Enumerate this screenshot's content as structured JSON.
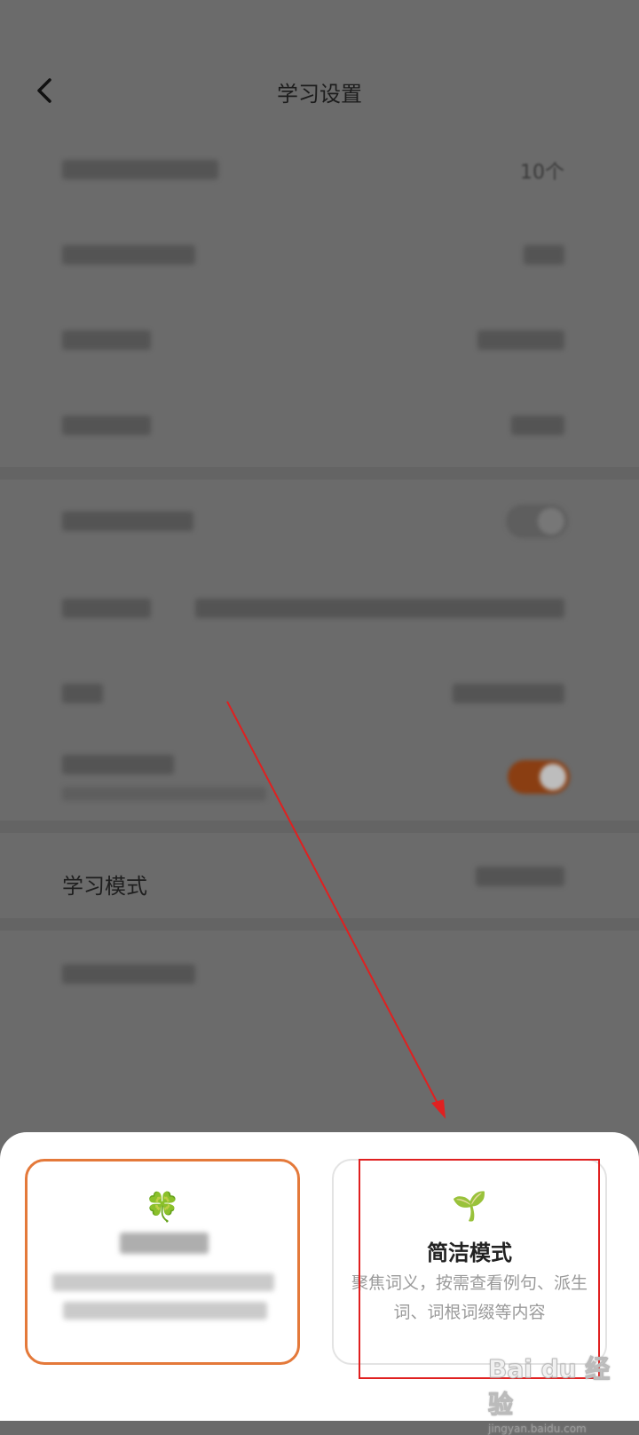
{
  "header": {
    "title": "学习设置"
  },
  "settings": {
    "row1_value": "10个",
    "mode_label": "学习模式"
  },
  "sheet": {
    "left_card": {
      "icon": "🍀"
    },
    "right_card": {
      "icon": "🌱",
      "name": "简洁模式",
      "desc": "聚焦词义，按需查看例句、派生词、词根词缀等内容"
    }
  },
  "watermark": {
    "text": "Bai du 经验",
    "sub": "jingyan.baidu.com"
  },
  "colors": {
    "accent": "#e4793a",
    "annotation": "#e02020"
  }
}
